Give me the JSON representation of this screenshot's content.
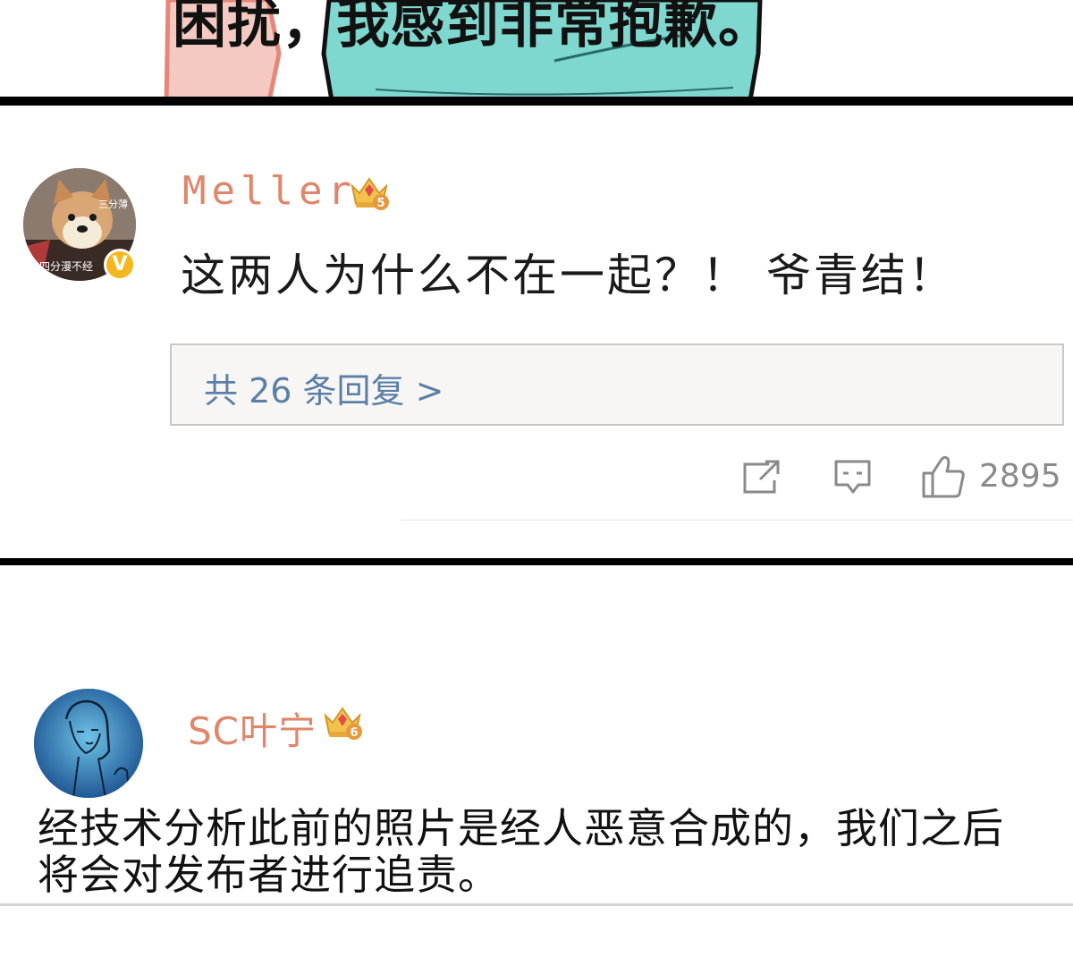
{
  "top_panel": {
    "caption": "困扰，我感到非常抱歉。"
  },
  "comment_1": {
    "avatar_watermark_top": "三分薄",
    "avatar_watermark_bottom": "四分漫不经",
    "verified_badge": "V",
    "username": "Meller",
    "vip_level": "5",
    "text": "这两人为什么不在一起？！ 爷青结！",
    "reply_link": "共 26 条回复 >",
    "like_count": "2895",
    "icons": [
      "share-icon",
      "comment-icon",
      "like-icon"
    ]
  },
  "comment_2": {
    "username": "SC叶宁",
    "vip_level": "6",
    "text": "经技术分析此前的照片是经人恶意合成的，我们之后将会对发布者进行追责。"
  },
  "colors": {
    "username": "#e0866a",
    "reply_link": "#5b7fa8",
    "verified": "#f4b71e",
    "meta_gray": "#8a8a8a"
  }
}
